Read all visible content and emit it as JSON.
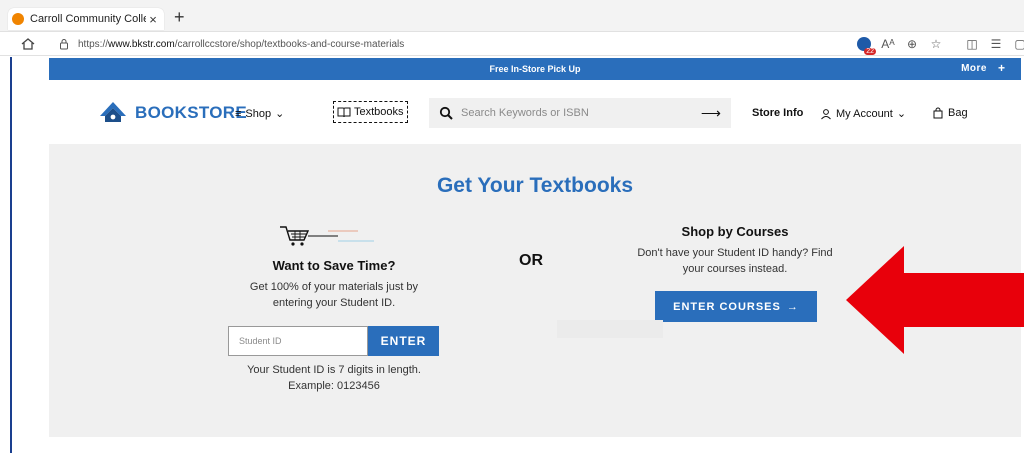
{
  "browser": {
    "tab_title": "Carroll Community College New",
    "tab_close": "×",
    "new_tab": "+",
    "url_prefix": "https://",
    "url_host": "www.bkstr.com",
    "url_path": "/carrollccstore/shop/textbooks-and-course-materials",
    "ext_badge": "22"
  },
  "promo": {
    "text": "Free In-Store Pick Up",
    "more_label": "More",
    "plus": "+"
  },
  "header": {
    "logo_text": "BOOKSTORE",
    "shop_label": "Shop",
    "textbooks_label": "Textbooks",
    "search_placeholder": "Search Keywords or ISBN",
    "store_info_label": "Store Info",
    "account_label": "My Account",
    "bag_label": "Bag"
  },
  "main": {
    "title": "Get Your Textbooks",
    "save": {
      "title": "Want to Save Time?",
      "desc": "Get 100% of your materials just by entering your Student ID.",
      "input_placeholder": "Student ID",
      "enter_label": "ENTER",
      "help": "Your Student ID is 7 digits in length. Example: 0123456"
    },
    "or_label": "OR",
    "courses": {
      "title": "Shop by Courses",
      "desc": "Don't have your Student ID handy? Find your courses instead.",
      "button_label": "ENTER COURSES",
      "button_arrow": "→"
    }
  },
  "colors": {
    "brand_blue": "#2a6ebb",
    "arrow_red": "#e8000b"
  }
}
